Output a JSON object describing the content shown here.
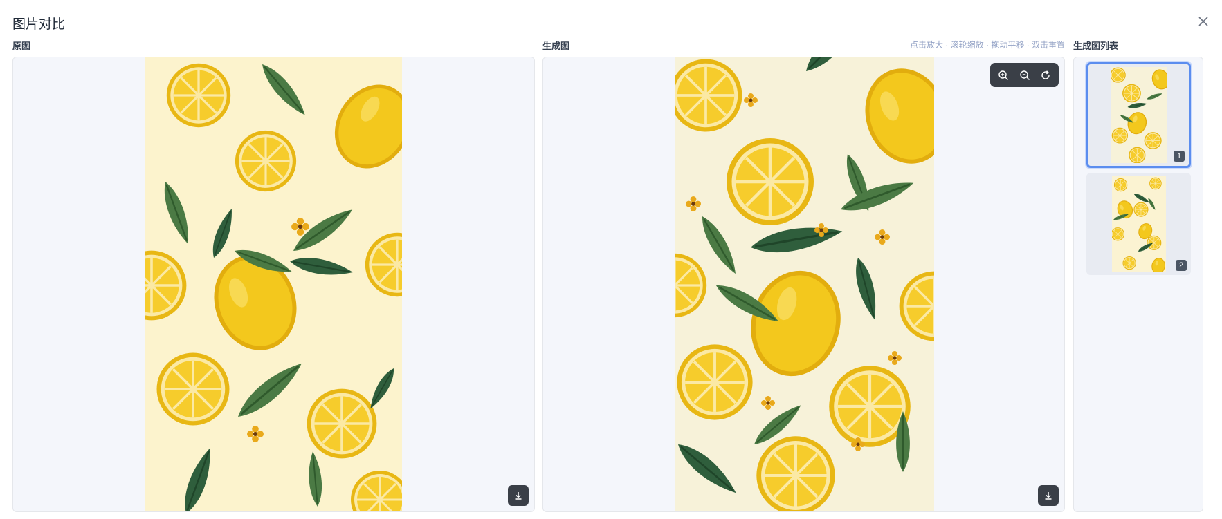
{
  "dialog": {
    "title": "图片对比"
  },
  "original": {
    "label": "原图",
    "download_icon": "download-icon"
  },
  "generated": {
    "label": "生成图",
    "hint": "点击放大 · 滚轮缩放 · 拖动平移 · 双击重置",
    "tools": {
      "zoom_in_icon": "zoom-in-icon",
      "zoom_out_icon": "zoom-out-icon",
      "reset_icon": "reset-icon"
    }
  },
  "list": {
    "label": "生成图列表",
    "items": [
      {
        "index": "1",
        "selected": true
      },
      {
        "index": "2",
        "selected": false
      }
    ]
  },
  "colors": {
    "accent": "#5b8def",
    "panel_bg": "#f4f6fb",
    "toolbar_bg": "#3a3f47",
    "lemon": "#f2c416",
    "leaf": "#3f6b3c",
    "cream": "#fcf3cd"
  }
}
